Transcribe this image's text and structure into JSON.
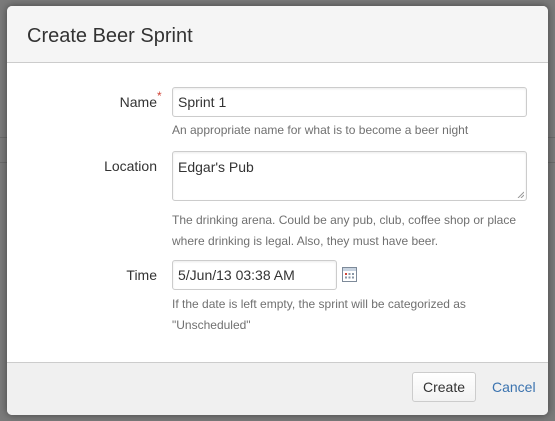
{
  "dialog": {
    "title": "Create Beer Sprint"
  },
  "form": {
    "name": {
      "label": "Name",
      "required_marker": "*",
      "value": "Sprint 1",
      "description": "An appropriate name for what is to become a beer night"
    },
    "location": {
      "label": "Location",
      "value": "Edgar's Pub",
      "description_line1": "The drinking arena. Could be any pub, club, coffee shop or place",
      "description_line2": "where drinking is legal. Also, they must have beer."
    },
    "time": {
      "label": "Time",
      "value": "5/Jun/13 03:38 AM",
      "description_line1": "If the date is left empty, the sprint will be categorized as",
      "description_line2": "\"Unscheduled\""
    }
  },
  "footer": {
    "create_label": "Create",
    "cancel_label": "Cancel"
  },
  "colors": {
    "link": "#3b73af",
    "required": "#d04437",
    "header_bg": "#f5f5f5",
    "footer_bg": "#f0f0f0"
  },
  "icons": {
    "calendar": "calendar-icon"
  }
}
